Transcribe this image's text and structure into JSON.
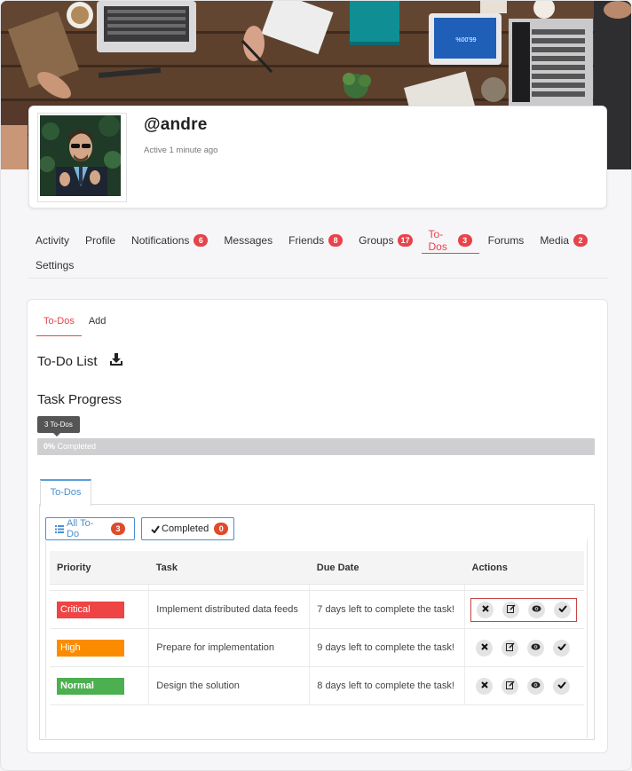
{
  "profile": {
    "username": "@andre",
    "active_status": "Active 1 minute ago"
  },
  "nav": {
    "items": [
      {
        "label": "Activity",
        "badge": null,
        "active": false
      },
      {
        "label": "Profile",
        "badge": null,
        "active": false
      },
      {
        "label": "Notifications",
        "badge": "6",
        "active": false
      },
      {
        "label": "Messages",
        "badge": null,
        "active": false
      },
      {
        "label": "Friends",
        "badge": "8",
        "active": false
      },
      {
        "label": "Groups",
        "badge": "17",
        "active": false
      },
      {
        "label": "To-Dos",
        "badge": "3",
        "active": true
      },
      {
        "label": "Forums",
        "badge": null,
        "active": false
      },
      {
        "label": "Media",
        "badge": "2",
        "active": false
      },
      {
        "label": "Settings",
        "badge": null,
        "active": false
      }
    ]
  },
  "subtabs": [
    "To-Dos",
    "Add"
  ],
  "todo_list": {
    "title": "To-Do List",
    "progress_heading": "Task Progress",
    "tooltip": "3 To-Dos",
    "progress_percent_label": "0%",
    "progress_label": "Completed",
    "progress_value": 0
  },
  "inner_tab": "To-Dos",
  "filters": {
    "all_label": "All To-Do",
    "all_count": "3",
    "completed_label": "Completed",
    "completed_count": "0"
  },
  "table": {
    "headers": [
      "Priority",
      "Task",
      "Due Date",
      "Actions"
    ],
    "rows": [
      {
        "priority": "Critical",
        "priority_color": "#ee4444",
        "task": "Implement distributed data feeds",
        "due": "7 days left to complete the task!"
      },
      {
        "priority": "High",
        "priority_color": "#fb8c00",
        "task": "Prepare for implementation",
        "due": "9 days left to complete the task!"
      },
      {
        "priority": "Normal",
        "priority_color": "#4caf50",
        "task": "Design the solution",
        "due": "8 days left to complete the task!"
      }
    ]
  },
  "colors": {
    "accent": "#e8434a",
    "link": "#4a90d0"
  },
  "icons": {
    "download": "download-icon",
    "list": "list-icon",
    "check": "check-icon",
    "delete": "close-icon",
    "edit": "edit-icon",
    "view": "eye-icon",
    "complete": "checkmark-icon"
  }
}
